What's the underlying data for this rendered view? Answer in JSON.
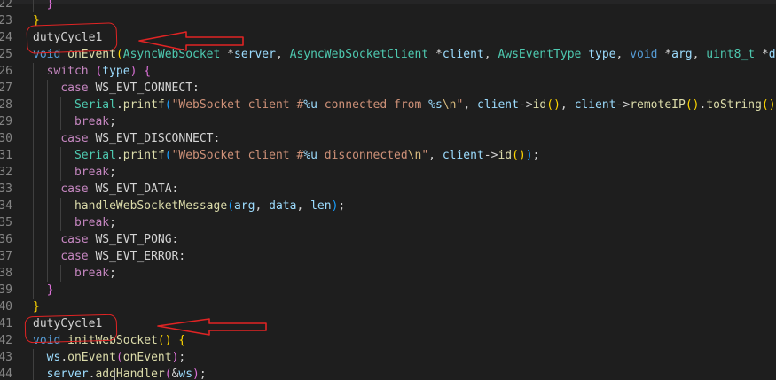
{
  "editor": {
    "lines": [
      {
        "num": "22",
        "tokens": [
          {
            "t": "  ",
            "c": "plain"
          },
          {
            "t": "}",
            "c": "brace2"
          }
        ]
      },
      {
        "num": "23",
        "tokens": [
          {
            "t": "}",
            "c": "brace1"
          }
        ]
      },
      {
        "num": "24",
        "tokens": [
          {
            "t": "dutyCycle1",
            "c": "plain"
          }
        ]
      },
      {
        "num": "25",
        "tokens": [
          {
            "t": "void",
            "c": "kw"
          },
          {
            "t": " ",
            "c": "plain"
          },
          {
            "t": "onEvent",
            "c": "fn"
          },
          {
            "t": "(",
            "c": "brace1"
          },
          {
            "t": "AsyncWebSocket",
            "c": "type"
          },
          {
            "t": " *",
            "c": "plain"
          },
          {
            "t": "server",
            "c": "param"
          },
          {
            "t": ", ",
            "c": "plain"
          },
          {
            "t": "AsyncWebSocketClient",
            "c": "type"
          },
          {
            "t": " *",
            "c": "plain"
          },
          {
            "t": "client",
            "c": "param"
          },
          {
            "t": ", ",
            "c": "plain"
          },
          {
            "t": "AwsEventType",
            "c": "type"
          },
          {
            "t": " ",
            "c": "plain"
          },
          {
            "t": "type",
            "c": "param"
          },
          {
            "t": ", ",
            "c": "plain"
          },
          {
            "t": "void",
            "c": "kw"
          },
          {
            "t": " *",
            "c": "plain"
          },
          {
            "t": "arg",
            "c": "param"
          },
          {
            "t": ", ",
            "c": "plain"
          },
          {
            "t": "uint8_t",
            "c": "type"
          },
          {
            "t": " *",
            "c": "plain"
          },
          {
            "t": "dat",
            "c": "param"
          }
        ]
      },
      {
        "num": "26",
        "tokens": [
          {
            "t": "  ",
            "c": "plain"
          },
          {
            "t": "switch",
            "c": "ctrl"
          },
          {
            "t": " ",
            "c": "plain"
          },
          {
            "t": "(",
            "c": "brace2"
          },
          {
            "t": "type",
            "c": "param"
          },
          {
            "t": ")",
            "c": "brace2"
          },
          {
            "t": " ",
            "c": "plain"
          },
          {
            "t": "{",
            "c": "brace2"
          }
        ]
      },
      {
        "num": "27",
        "tokens": [
          {
            "t": "    ",
            "c": "plain"
          },
          {
            "t": "case",
            "c": "ctrl"
          },
          {
            "t": " WS_EVT_CONNECT:",
            "c": "plain"
          }
        ]
      },
      {
        "num": "28",
        "tokens": [
          {
            "t": "      ",
            "c": "plain"
          },
          {
            "t": "Serial",
            "c": "type"
          },
          {
            "t": ".",
            "c": "plain"
          },
          {
            "t": "printf",
            "c": "fn"
          },
          {
            "t": "(",
            "c": "brace3"
          },
          {
            "t": "\"WebSocket client #",
            "c": "str"
          },
          {
            "t": "%u",
            "c": "fmt"
          },
          {
            "t": " connected from ",
            "c": "str"
          },
          {
            "t": "%s",
            "c": "fmt"
          },
          {
            "t": "\\n",
            "c": "esc"
          },
          {
            "t": "\"",
            "c": "str"
          },
          {
            "t": ", ",
            "c": "plain"
          },
          {
            "t": "client",
            "c": "param"
          },
          {
            "t": "->",
            "c": "plain"
          },
          {
            "t": "id",
            "c": "fn"
          },
          {
            "t": "()",
            "c": "brace1"
          },
          {
            "t": ", ",
            "c": "plain"
          },
          {
            "t": "client",
            "c": "param"
          },
          {
            "t": "->",
            "c": "plain"
          },
          {
            "t": "remoteIP",
            "c": "fn"
          },
          {
            "t": "()",
            "c": "brace1"
          },
          {
            "t": ".",
            "c": "plain"
          },
          {
            "t": "toString",
            "c": "fn"
          },
          {
            "t": "()",
            "c": "brace1"
          },
          {
            "t": ".",
            "c": "plain"
          },
          {
            "t": "c",
            "c": "fn"
          }
        ]
      },
      {
        "num": "29",
        "tokens": [
          {
            "t": "      ",
            "c": "plain"
          },
          {
            "t": "break",
            "c": "ctrl"
          },
          {
            "t": ";",
            "c": "plain"
          }
        ]
      },
      {
        "num": "30",
        "tokens": [
          {
            "t": "    ",
            "c": "plain"
          },
          {
            "t": "case",
            "c": "ctrl"
          },
          {
            "t": " WS_EVT_DISCONNECT:",
            "c": "plain"
          }
        ]
      },
      {
        "num": "31",
        "tokens": [
          {
            "t": "      ",
            "c": "plain"
          },
          {
            "t": "Serial",
            "c": "type"
          },
          {
            "t": ".",
            "c": "plain"
          },
          {
            "t": "printf",
            "c": "fn"
          },
          {
            "t": "(",
            "c": "brace3"
          },
          {
            "t": "\"WebSocket client #",
            "c": "str"
          },
          {
            "t": "%u",
            "c": "fmt"
          },
          {
            "t": " disconnected",
            "c": "str"
          },
          {
            "t": "\\n",
            "c": "esc"
          },
          {
            "t": "\"",
            "c": "str"
          },
          {
            "t": ", ",
            "c": "plain"
          },
          {
            "t": "client",
            "c": "param"
          },
          {
            "t": "->",
            "c": "plain"
          },
          {
            "t": "id",
            "c": "fn"
          },
          {
            "t": "()",
            "c": "brace1"
          },
          {
            "t": ")",
            "c": "brace3"
          },
          {
            "t": ";",
            "c": "plain"
          }
        ]
      },
      {
        "num": "32",
        "tokens": [
          {
            "t": "      ",
            "c": "plain"
          },
          {
            "t": "break",
            "c": "ctrl"
          },
          {
            "t": ";",
            "c": "plain"
          }
        ]
      },
      {
        "num": "33",
        "tokens": [
          {
            "t": "    ",
            "c": "plain"
          },
          {
            "t": "case",
            "c": "ctrl"
          },
          {
            "t": " WS_EVT_DATA:",
            "c": "plain"
          }
        ]
      },
      {
        "num": "34",
        "tokens": [
          {
            "t": "      ",
            "c": "plain"
          },
          {
            "t": "handleWebSocketMessage",
            "c": "fn"
          },
          {
            "t": "(",
            "c": "brace3"
          },
          {
            "t": "arg",
            "c": "param"
          },
          {
            "t": ", ",
            "c": "plain"
          },
          {
            "t": "data",
            "c": "param"
          },
          {
            "t": ", ",
            "c": "plain"
          },
          {
            "t": "len",
            "c": "param"
          },
          {
            "t": ")",
            "c": "brace3"
          },
          {
            "t": ";",
            "c": "plain"
          }
        ]
      },
      {
        "num": "35",
        "tokens": [
          {
            "t": "      ",
            "c": "plain"
          },
          {
            "t": "break",
            "c": "ctrl"
          },
          {
            "t": ";",
            "c": "plain"
          }
        ]
      },
      {
        "num": "36",
        "tokens": [
          {
            "t": "    ",
            "c": "plain"
          },
          {
            "t": "case",
            "c": "ctrl"
          },
          {
            "t": " WS_EVT_PONG:",
            "c": "plain"
          }
        ]
      },
      {
        "num": "37",
        "tokens": [
          {
            "t": "    ",
            "c": "plain"
          },
          {
            "t": "case",
            "c": "ctrl"
          },
          {
            "t": " WS_EVT_ERROR:",
            "c": "plain"
          }
        ]
      },
      {
        "num": "38",
        "tokens": [
          {
            "t": "      ",
            "c": "plain"
          },
          {
            "t": "break",
            "c": "ctrl"
          },
          {
            "t": ";",
            "c": "plain"
          }
        ]
      },
      {
        "num": "39",
        "tokens": [
          {
            "t": "  ",
            "c": "plain"
          },
          {
            "t": "}",
            "c": "brace2"
          }
        ]
      },
      {
        "num": "40",
        "tokens": [
          {
            "t": "}",
            "c": "brace1"
          }
        ]
      },
      {
        "num": "41",
        "tokens": [
          {
            "t": "dutyCycle1",
            "c": "plain"
          }
        ]
      },
      {
        "num": "42",
        "tokens": [
          {
            "t": "void",
            "c": "kw"
          },
          {
            "t": " ",
            "c": "plain"
          },
          {
            "t": "initWebSocket",
            "c": "fn"
          },
          {
            "t": "()",
            "c": "brace1"
          },
          {
            "t": " ",
            "c": "plain"
          },
          {
            "t": "{",
            "c": "brace1"
          }
        ]
      },
      {
        "num": "43",
        "tokens": [
          {
            "t": "  ",
            "c": "plain"
          },
          {
            "t": "ws",
            "c": "param"
          },
          {
            "t": ".",
            "c": "plain"
          },
          {
            "t": "onEvent",
            "c": "fn"
          },
          {
            "t": "(",
            "c": "brace2"
          },
          {
            "t": "onEvent",
            "c": "fn"
          },
          {
            "t": ")",
            "c": "brace2"
          },
          {
            "t": ";",
            "c": "plain"
          }
        ]
      },
      {
        "num": "44",
        "tokens": [
          {
            "t": "  ",
            "c": "plain"
          },
          {
            "t": "server",
            "c": "param"
          },
          {
            "t": ".",
            "c": "plain"
          },
          {
            "t": "addHandler",
            "c": "fn"
          },
          {
            "t": "(",
            "c": "brace2"
          },
          {
            "t": "&",
            "c": "plain"
          },
          {
            "t": "ws",
            "c": "param"
          },
          {
            "t": ")",
            "c": "brace2"
          },
          {
            "t": ";",
            "c": "plain"
          }
        ]
      }
    ]
  },
  "theme": {
    "background": "#1e1e1e",
    "gutter_text": "#858585",
    "annotation_red": "#e02424",
    "token_colors": {
      "plain": "#d4d4d4",
      "kw": "#569cd6",
      "ctrl": "#c586c0",
      "fn": "#dcdcaa",
      "type": "#4ec9b0",
      "param": "#9cdcfe",
      "str": "#ce9178",
      "fmt": "#9cdcfe",
      "esc": "#d7ba7d",
      "brace1": "#ffd700",
      "brace2": "#da70d6",
      "brace3": "#179fff"
    }
  },
  "annotations": [
    {
      "kind": "circle-with-arrow",
      "target_line": "24",
      "icon": "red-arrow-left-icon"
    },
    {
      "kind": "circle-with-arrow",
      "target_line": "41",
      "icon": "red-arrow-left-icon"
    }
  ]
}
